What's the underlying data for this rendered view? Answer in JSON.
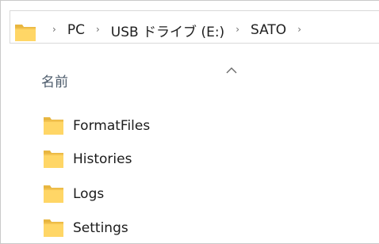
{
  "address_bar": {
    "path": [
      "PC",
      "USB ドライブ (E:)",
      "SATO"
    ],
    "separator": "›",
    "folder_icon": "folder-icon"
  },
  "columns": {
    "name_header": "名前",
    "sort_icon": "sort-ascending-icon"
  },
  "items": [
    {
      "label": "FormatFiles",
      "icon": "folder-icon"
    },
    {
      "label": "Histories",
      "icon": "folder-icon"
    },
    {
      "label": "Logs",
      "icon": "folder-icon"
    },
    {
      "label": "Settings",
      "icon": "folder-icon"
    }
  ],
  "colors": {
    "folder_body": "#FFD666",
    "folder_shade": "#E8B640",
    "folder_tab": "#F4C451",
    "address_border": "#D9D9D9",
    "header_text": "#4B5A6A"
  }
}
